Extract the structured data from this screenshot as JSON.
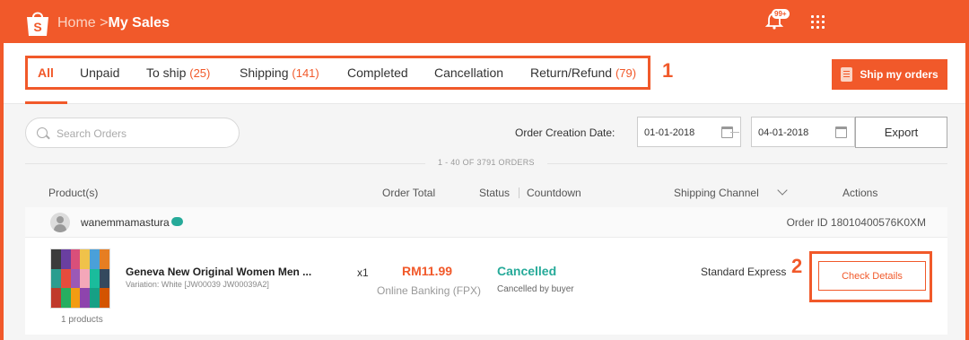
{
  "header": {
    "breadcrumb_home": "Home",
    "breadcrumb_separator": ">",
    "breadcrumb_current": "My Sales",
    "notification_badge": "99+",
    "accent_color": "#f1592a"
  },
  "tabs": [
    {
      "label": "All",
      "count": "",
      "active": true
    },
    {
      "label": "Unpaid",
      "count": ""
    },
    {
      "label": "To ship",
      "count": "(25)"
    },
    {
      "label": "Shipping",
      "count": "(141)"
    },
    {
      "label": "Completed",
      "count": ""
    },
    {
      "label": "Cancellation",
      "count": ""
    },
    {
      "label": "Return/Refund",
      "count": "(79)"
    }
  ],
  "annotations": {
    "tabs_marker": "1",
    "details_marker": "2"
  },
  "ship_button_label": "Ship my orders",
  "filters": {
    "search_placeholder": "Search Orders",
    "date_label": "Order Creation Date:",
    "date_from": "01-01-2018",
    "date_to": "04-01-2018",
    "export_label": "Export"
  },
  "results_count": "1 - 40 OF 3791 ORDERS",
  "table_headers": {
    "product": "Product(s)",
    "order_total": "Order Total",
    "status": "Status",
    "countdown": "Countdown",
    "shipping_channel": "Shipping Channel",
    "actions": "Actions"
  },
  "order": {
    "buyer": "wanemmamastura",
    "order_id": "Order ID 18010400576K0XM",
    "product_name": "Geneva New Original Women Men ...",
    "variation": "Variation: White [JW00039 JW00039A2]",
    "products_count": "1 products",
    "quantity": "x1",
    "price": "RM11.99",
    "payment_method": "Online Banking (FPX)",
    "status": "Cancelled",
    "status_detail": "Cancelled by buyer",
    "shipping_channel": "Standard Express",
    "action_label": "Check Details",
    "status_color": "#26aa99",
    "thumbnail_colors": [
      "#3b3b3b",
      "#6a3fa0",
      "#d94f7a",
      "#f0c24a",
      "#4aa0d9",
      "#e67e22",
      "#2a9d8f",
      "#e74c3c",
      "#9b59b6",
      "#f4a7b9",
      "#1abc9c",
      "#34495e",
      "#c0392b",
      "#27ae60",
      "#f39c12",
      "#8e44ad",
      "#16a085",
      "#d35400"
    ]
  }
}
